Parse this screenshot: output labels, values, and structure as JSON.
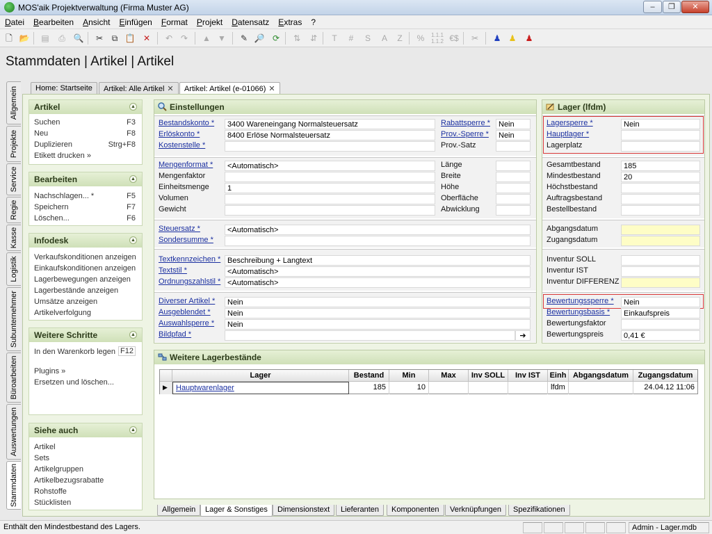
{
  "window": {
    "title": "MOS'aik Projektverwaltung (Firma Muster AG)",
    "min": "–",
    "max": "❐",
    "close": "✕"
  },
  "menu": [
    "Datei",
    "Bearbeiten",
    "Ansicht",
    "Einfügen",
    "Format",
    "Projekt",
    "Datensatz",
    "Extras",
    "?"
  ],
  "page_title": "Stammdaten | Artikel | Artikel",
  "doc_tabs": [
    {
      "label": "Home: Startseite"
    },
    {
      "label": "Artikel: Alle Artikel"
    },
    {
      "label": "Artikel: Artikel (e-01066)"
    }
  ],
  "close_glyph": "✕",
  "vertical_tabs": [
    "Allgemein",
    "Projekte",
    "Service",
    "Regie",
    "Kasse",
    "Logistik",
    "Subunternehmer",
    "Büroarbeiten",
    "Auswertungen",
    "Stammdaten"
  ],
  "sidebar": {
    "artikel": {
      "title": "Artikel",
      "items": [
        {
          "label": "Suchen",
          "key": "F3"
        },
        {
          "label": "Neu",
          "key": "F8"
        },
        {
          "label": "Duplizieren",
          "key": "Strg+F8"
        },
        {
          "label": "Etikett drucken »",
          "key": ""
        }
      ]
    },
    "bearbeiten": {
      "title": "Bearbeiten",
      "items": [
        {
          "label": "Nachschlagen... *",
          "key": "F5"
        },
        {
          "label": "Speichern",
          "key": "F7"
        },
        {
          "label": "Löschen...",
          "key": "F6"
        }
      ]
    },
    "infodesk": {
      "title": "Infodesk",
      "items": [
        "Verkaufskonditionen anzeigen",
        "Einkaufskonditionen anzeigen",
        "Lagerbewegungen anzeigen",
        "Lagerbestände anzeigen",
        "Umsätze anzeigen",
        "Artikelverfolgung"
      ]
    },
    "weitere": {
      "title": "Weitere Schritte",
      "items": [
        {
          "label": "In den Warenkorb legen",
          "key": "F12"
        },
        {
          "label": "Plugins »",
          "key": ""
        },
        {
          "label": "Ersetzen und löschen...",
          "key": ""
        }
      ]
    },
    "siehe": {
      "title": "Siehe auch",
      "items": [
        "Artikel",
        "Sets",
        "Artikelgruppen",
        "Artikelbezugsrabatte",
        "Rohstoffe",
        "Stücklisten"
      ]
    }
  },
  "collapse_glyph": "▲",
  "einstellungen": {
    "title": "Einstellungen",
    "konten": [
      {
        "label": "Bestandskonto *",
        "value": "3400 Wareneingang Normalsteuersatz"
      },
      {
        "label": "Erlöskonto *",
        "value": "8400 Erlöse Normalsteuersatz"
      },
      {
        "label": "Kostenstelle *",
        "value": ""
      }
    ],
    "konten_right": [
      {
        "label": "Rabattsperre *",
        "value": "Nein"
      },
      {
        "label": "Prov.-Sperre *",
        "value": "Nein"
      },
      {
        "label": "Prov.-Satz",
        "value": ""
      }
    ],
    "mengen": [
      {
        "label": "Mengenformat *",
        "value": "<Automatisch>"
      },
      {
        "label": "Mengenfaktor",
        "value": ""
      },
      {
        "label": "Einheitsmenge",
        "value": "1"
      },
      {
        "label": "Volumen",
        "value": ""
      },
      {
        "label": "Gewicht",
        "value": ""
      }
    ],
    "mengen_right": [
      {
        "label": "Länge",
        "value": ""
      },
      {
        "label": "Breite",
        "value": ""
      },
      {
        "label": "Höhe",
        "value": ""
      },
      {
        "label": "Oberfläche",
        "value": ""
      },
      {
        "label": "Abwicklung",
        "value": ""
      }
    ],
    "steuer": [
      {
        "label": "Steuersatz *",
        "value": "<Automatisch>"
      },
      {
        "label": "Sondersumme *",
        "value": ""
      }
    ],
    "text": [
      {
        "label": "Textkennzeichen *",
        "value": "Beschreibung + Langtext"
      },
      {
        "label": "Textstil *",
        "value": "<Automatisch>"
      },
      {
        "label": "Ordnungszahlstil *",
        "value": "<Automatisch>"
      }
    ],
    "divers": [
      {
        "label": "Diverser Artikel *",
        "value": "Nein"
      },
      {
        "label": "Ausgeblendet *",
        "value": "Nein"
      },
      {
        "label": "Auswahlsperre *",
        "value": "Nein"
      },
      {
        "label": "Bildpfad *",
        "value": ""
      }
    ],
    "browse_glyph": "➔"
  },
  "lager": {
    "title": "Lager (lfdm)",
    "sperre": [
      {
        "label": "Lagersperre *",
        "value": "Nein"
      },
      {
        "label": "Hauptlager *",
        "value": ""
      },
      {
        "label": "Lagerplatz",
        "value": ""
      }
    ],
    "bestand": [
      {
        "label": "Gesamtbestand",
        "value": "185"
      },
      {
        "label": "Mindestbestand",
        "value": "20"
      },
      {
        "label": "Höchstbestand",
        "value": ""
      },
      {
        "label": "Auftragsbestand",
        "value": ""
      },
      {
        "label": "Bestellbestand",
        "value": ""
      }
    ],
    "datum": [
      {
        "label": "Abgangsdatum",
        "value": ""
      },
      {
        "label": "Zugangsdatum",
        "value": ""
      }
    ],
    "inventur": [
      {
        "label": "Inventur SOLL",
        "value": ""
      },
      {
        "label": "Inventur IST",
        "value": ""
      },
      {
        "label": "Inventur DIFFERENZ",
        "value": ""
      }
    ],
    "bewertung": [
      {
        "label": "Bewertungssperre *",
        "value": "Nein"
      },
      {
        "label": "Bewertungsbasis *",
        "value": "Einkaufspreis"
      },
      {
        "label": "Bewertungsfaktor",
        "value": ""
      },
      {
        "label": "Bewertungspreis",
        "value": "0,41 €"
      }
    ]
  },
  "weitere_lager": {
    "title": "Weitere Lagerbestände",
    "columns": [
      "Lager",
      "Bestand",
      "Min",
      "Max",
      "Inv SOLL",
      "Inv IST",
      "Einh",
      "Abgangsdatum",
      "Zugangsdatum"
    ],
    "rows": [
      [
        "Hauptwarenlager",
        "185",
        "10",
        "",
        "",
        "",
        "lfdm",
        "",
        "24.04.12 11:06"
      ]
    ],
    "row_marker": "▶"
  },
  "bottom_tabs": [
    "Allgemein",
    "Lager & Sonstiges",
    "Dimensionstext",
    "Lieferanten",
    "Komponenten",
    "Verknüpfungen",
    "Spezifikationen"
  ],
  "status": {
    "message": "Enthält den Mindestbestand des Lagers.",
    "user": "Admin - Lager.mdb"
  },
  "colors": {
    "accent_green": "#cfe0b8",
    "link_blue": "#1a2fa0",
    "highlight_red": "#d93838",
    "yellow_field": "#fefdc6"
  }
}
